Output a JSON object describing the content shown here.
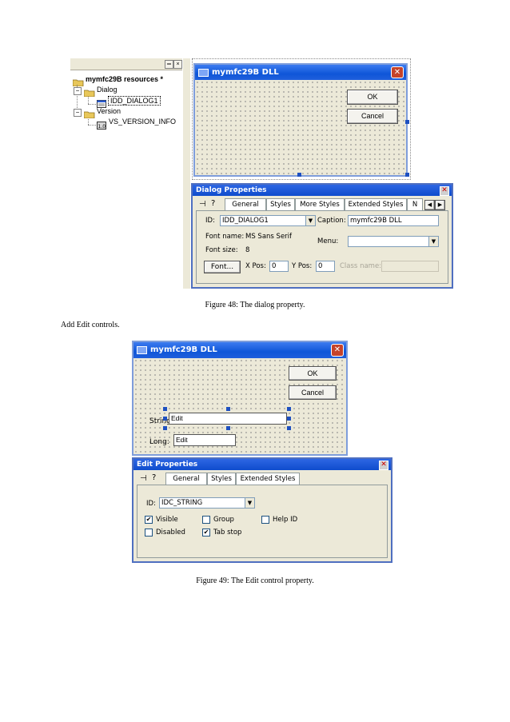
{
  "figure48": {
    "tree": {
      "root_label": "mymfc29B resources *",
      "dialog_folder": "Dialog",
      "dialog_item": "IDD_DIALOG1",
      "version_folder": "Version",
      "version_item": "VS_VERSION_INFO"
    },
    "dialog": {
      "title": "mymfc29B DLL",
      "ok_label": "OK",
      "cancel_label": "Cancel"
    },
    "properties": {
      "title": "Dialog Properties",
      "tabs": [
        "General",
        "Styles",
        "More Styles",
        "Extended Styles",
        "N"
      ],
      "id_label": "ID:",
      "id_value": "IDD_DIALOG1",
      "caption_label": "Caption:",
      "caption_value": "mymfc29B DLL",
      "font_name_label": "Font name:",
      "font_name_value": "MS Sans Serif",
      "font_size_label": "Font size:",
      "font_size_value": "8",
      "menu_label": "Menu:",
      "font_button": "Font...",
      "xpos_label": "X Pos:",
      "xpos_value": "0",
      "ypos_label": "Y Pos:",
      "ypos_value": "0",
      "class_name_label": "Class name:"
    },
    "caption": "Figure 48: The dialog property."
  },
  "body_text": "Add Edit controls.",
  "figure49": {
    "dialog": {
      "title": "mymfc29B DLL",
      "ok_label": "OK",
      "cancel_label": "Cancel",
      "string_label": "String:",
      "long_label": "Long:",
      "edit1_text": "Edit",
      "edit2_text": "Edit"
    },
    "properties": {
      "title": "Edit Properties",
      "tabs": [
        "General",
        "Styles",
        "Extended Styles"
      ],
      "id_label": "ID:",
      "id_value": "IDC_STRING",
      "visible_label": "Visible",
      "visible_checked": "✔",
      "group_label": "Group",
      "help_id_label": "Help ID",
      "disabled_label": "Disabled",
      "tab_stop_label": "Tab stop",
      "tab_stop_checked": "✔"
    },
    "caption": "Figure 49: The Edit control property."
  }
}
